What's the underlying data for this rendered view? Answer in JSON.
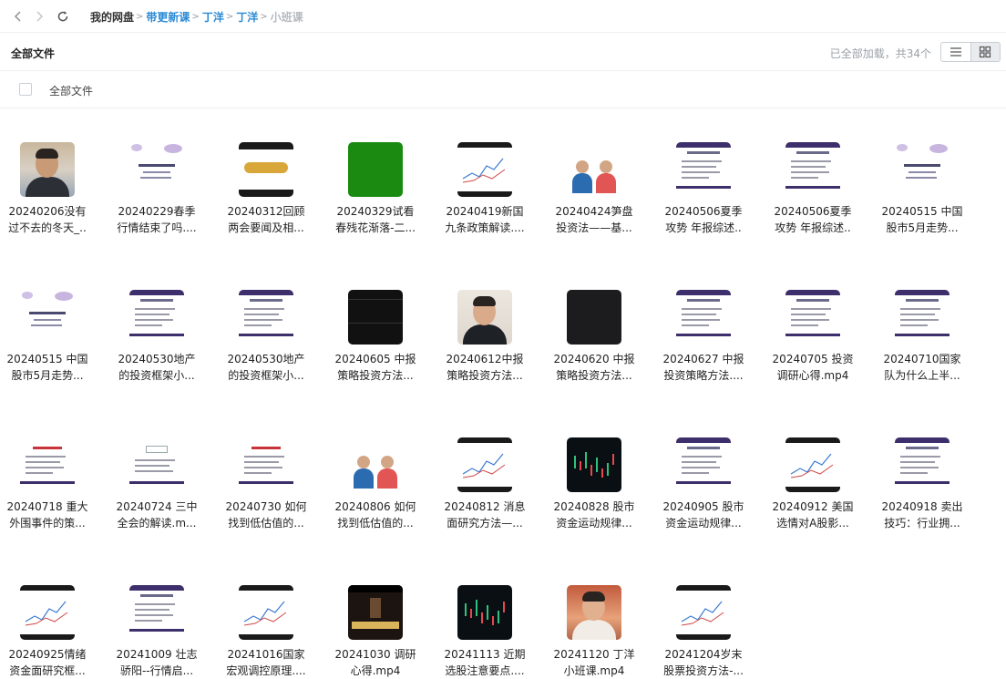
{
  "nav": {
    "breadcrumbs": [
      {
        "label": "我的网盘",
        "kind": "root"
      },
      {
        "label": "带更新课",
        "kind": "link"
      },
      {
        "label": "丁洋",
        "kind": "link"
      },
      {
        "label": "丁洋",
        "kind": "link"
      },
      {
        "label": "小班课",
        "kind": "current"
      }
    ],
    "separator": ">",
    "icons": [
      "back-icon",
      "forward-icon",
      "refresh-icon"
    ]
  },
  "header": {
    "title": "全部文件",
    "status": "已全部加载，共34个",
    "view_icons": [
      "list-view-icon",
      "grid-view-icon"
    ]
  },
  "select_all": {
    "label": "全部文件"
  },
  "files": [
    {
      "line1": "20240206没有",
      "line2": "过不去的冬天_..",
      "thumb": "face"
    },
    {
      "line1": "20240229春季",
      "line2": "行情结束了吗....",
      "thumb": "calli"
    },
    {
      "line1": "20240312回顾",
      "line2": "两会要闻及相...",
      "thumb": "gold"
    },
    {
      "line1": "20240329试看",
      "line2": "春残花渐落-二...",
      "thumb": "green"
    },
    {
      "line1": "20240419新国",
      "line2": "九条政策解读....",
      "thumb": "chart"
    },
    {
      "line1": "20240424笋盘",
      "line2": "投资法——基...",
      "thumb": "people"
    },
    {
      "line1": "20240506夏季",
      "line2": "攻势 年报综述..",
      "thumb": "slide"
    },
    {
      "line1": "20240506夏季",
      "line2": "攻势 年报综述..",
      "thumb": "slide"
    },
    {
      "line1": "20240515 中国",
      "line2": "股市5月走势...",
      "thumb": "calli"
    },
    {
      "line1": "20240515 中国",
      "line2": "股市5月走势...",
      "thumb": "calli"
    },
    {
      "line1": "20240530地产",
      "line2": "的投资框架小...",
      "thumb": "slide"
    },
    {
      "line1": "20240530地产",
      "line2": "的投资框架小...",
      "thumb": "slide"
    },
    {
      "line1": "20240605 中报",
      "line2": "策略投资方法...",
      "thumb": "dark"
    },
    {
      "line1": "20240612中报",
      "line2": "策略投资方法...",
      "thumb": "face2"
    },
    {
      "line1": "20240620 中报",
      "line2": "策略投资方法...",
      "thumb": "black"
    },
    {
      "line1": "20240627 中报",
      "line2": "投资策略方法....",
      "thumb": "slide"
    },
    {
      "line1": "20240705 投资",
      "line2": "调研心得.mp4",
      "thumb": "slide"
    },
    {
      "line1": "20240710国家",
      "line2": "队为什么上半...",
      "thumb": "slide"
    },
    {
      "line1": "20240718 重大",
      "line2": "外围事件的策...",
      "thumb": "slide-red"
    },
    {
      "line1": "20240724 三中",
      "line2": "全会的解读.m...",
      "thumb": "slide-tab"
    },
    {
      "line1": "20240730 如何",
      "line2": "找到低估值的...",
      "thumb": "slide-red"
    },
    {
      "line1": "20240806 如何",
      "line2": "找到低估值的...",
      "thumb": "people"
    },
    {
      "line1": "20240812 消息",
      "line2": "面研究方法—...",
      "thumb": "chart"
    },
    {
      "line1": "20240828 股市",
      "line2": "资金运动规律...",
      "thumb": "candle"
    },
    {
      "line1": "20240905 股市",
      "line2": "资金运动规律...",
      "thumb": "slide"
    },
    {
      "line1": "20240912 美国",
      "line2": "选情对A股影...",
      "thumb": "chart"
    },
    {
      "line1": "20240918 卖出",
      "line2": "技巧：行业拥...",
      "thumb": "slide"
    },
    {
      "line1": "20240925情绪",
      "line2": "资金面研究框...",
      "thumb": "chart"
    },
    {
      "line1": "20241009 壮志",
      "line2": "骄阳--行情启...",
      "thumb": "slide"
    },
    {
      "line1": "20241016国家",
      "line2": "宏观调控原理....",
      "thumb": "chart"
    },
    {
      "line1": "20241030 调研",
      "line2": "心得.mp4",
      "thumb": "stage"
    },
    {
      "line1": "20241113 近期",
      "line2": "选股注意要点....",
      "thumb": "candle"
    },
    {
      "line1": "20241120 丁洋",
      "line2": "小班课.mp4",
      "thumb": "face3"
    },
    {
      "line1": "20241204岁末",
      "line2": "股票投资方法-...",
      "thumb": "chart"
    }
  ],
  "colors": {
    "link": "#2a8ad4",
    "muted": "#9aa0a6",
    "text": "#222222",
    "divider": "#eef0f3"
  }
}
